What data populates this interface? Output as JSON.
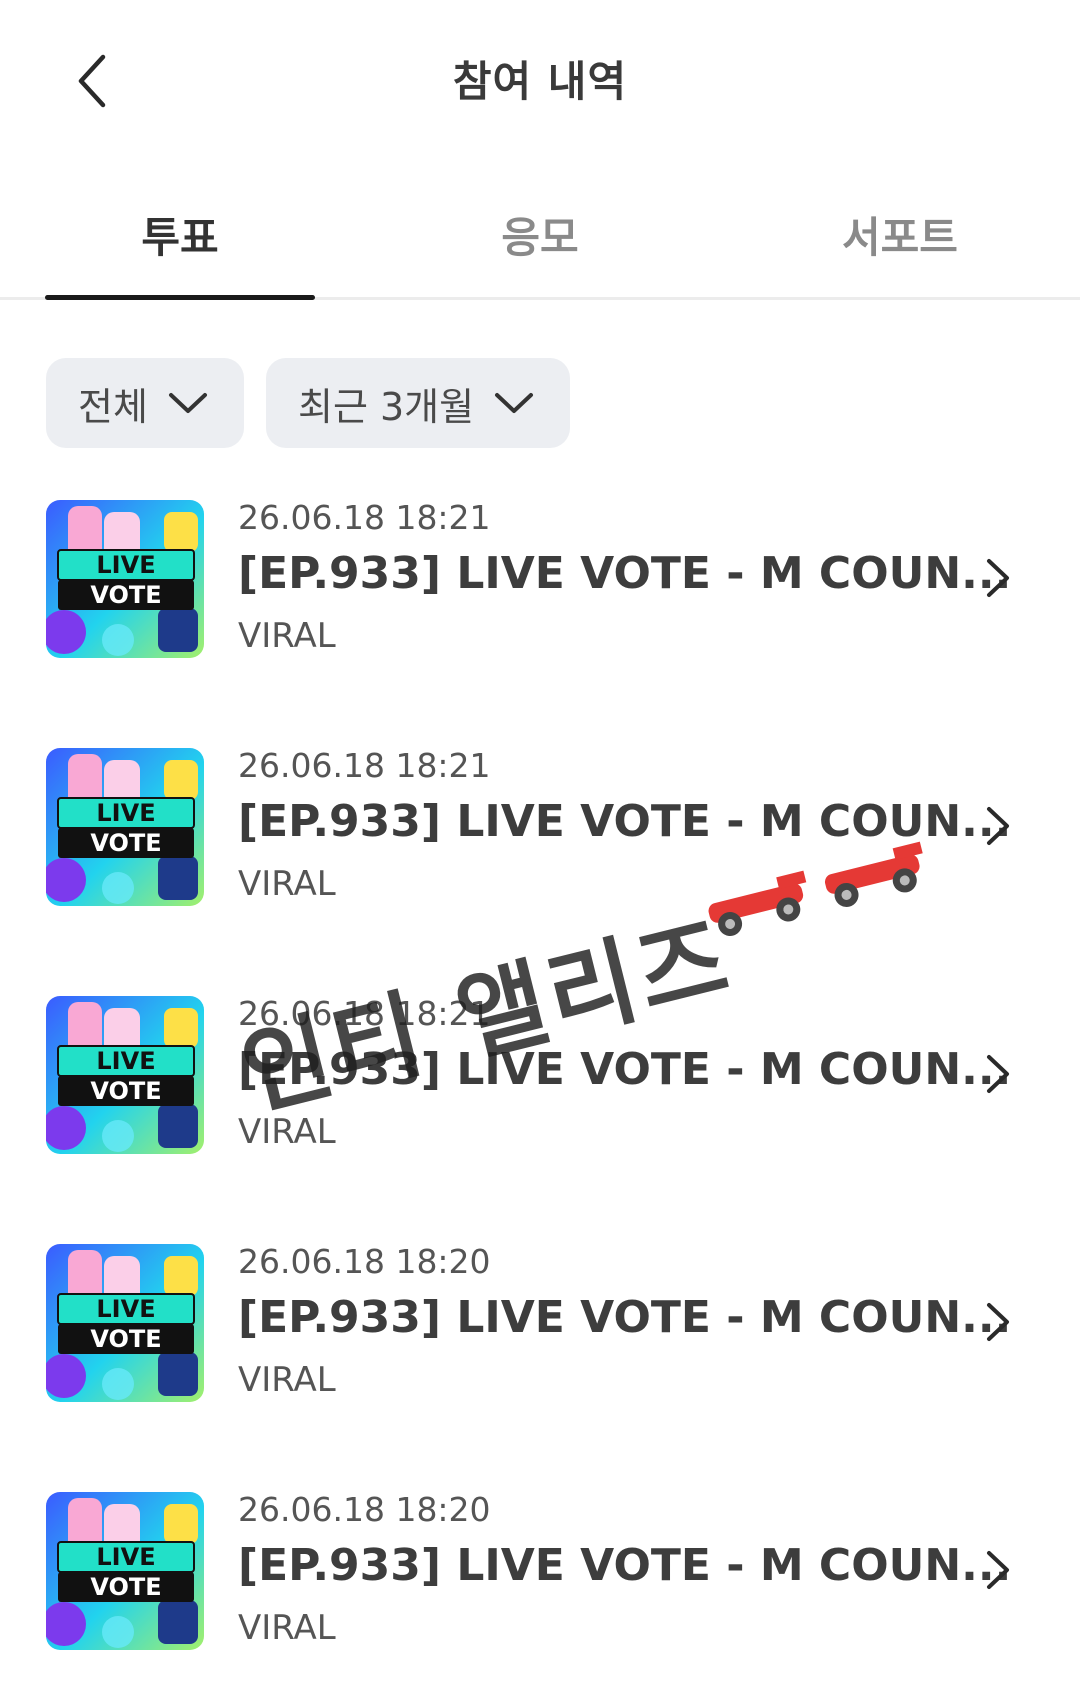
{
  "header": {
    "title": "참여 내역",
    "back_icon": "chevron-left-icon"
  },
  "tabs": [
    {
      "label": "투표",
      "active": true
    },
    {
      "label": "응모",
      "active": false
    },
    {
      "label": "서포트",
      "active": false
    }
  ],
  "filters": [
    {
      "label": "전체",
      "icon": "chevron-down-icon"
    },
    {
      "label": "최근 3개월",
      "icon": "chevron-down-icon"
    }
  ],
  "items": [
    {
      "date": "26.06.18 18:21",
      "title": "[EP.933] LIVE VOTE - M COUN...",
      "source": "VIRAL",
      "thumb_text": [
        "LIVE",
        "VOTE"
      ]
    },
    {
      "date": "26.06.18 18:21",
      "title": "[EP.933] LIVE VOTE - M COUN...",
      "source": "VIRAL",
      "thumb_text": [
        "LIVE",
        "VOTE"
      ]
    },
    {
      "date": "26.06.18 18:21",
      "title": "[EP.933] LIVE VOTE - M COUN...",
      "source": "VIRAL",
      "thumb_text": [
        "LIVE",
        "VOTE"
      ]
    },
    {
      "date": "26.06.18 18:20",
      "title": "[EP.933] LIVE VOTE - M COUN...",
      "source": "VIRAL",
      "thumb_text": [
        "LIVE",
        "VOTE"
      ]
    },
    {
      "date": "26.06.18 18:20",
      "title": "[EP.933] LIVE VOTE - M COUN...",
      "source": "VIRAL",
      "thumb_text": [
        "LIVE",
        "VOTE"
      ]
    }
  ],
  "watermark": {
    "text": "인티 앨리즈",
    "icon": "race-car-icon"
  },
  "colors": {
    "text_primary": "#333333",
    "tab_inactive": "#8a8a8a",
    "chip_bg": "#eceef2",
    "indicator": "#1a1a1a"
  }
}
